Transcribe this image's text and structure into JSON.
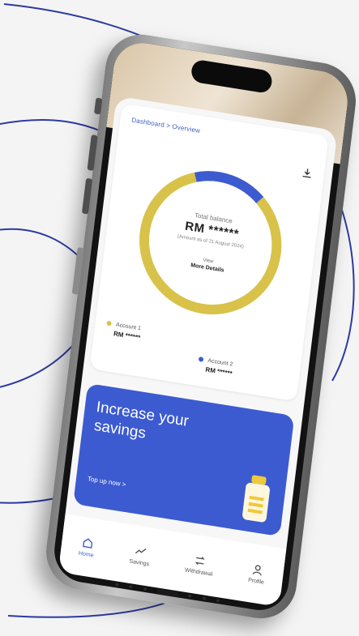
{
  "app": {
    "breadcrumb": "Dashboard > Overview",
    "summary": {
      "total_label": "Total balance",
      "total_value": "RM ******",
      "total_sub": "(Amount as of 21 August 2024)",
      "more_label": "View",
      "more_link": "More Details"
    },
    "donut": {
      "blue_fraction": 0.17,
      "colors": {
        "blue": "#3c5bd1",
        "gold": "#d8c24a"
      }
    },
    "legend": [
      {
        "label": "Account 1",
        "amount": "RM ******",
        "color": "#d8c24a"
      },
      {
        "label": "Account 2",
        "amount": "RM ******",
        "color": "#3c5bd1"
      }
    ],
    "promo": {
      "title": "Increase your savings",
      "cta": "Top up now >"
    },
    "nav": [
      {
        "label": "Home",
        "icon": "home-icon",
        "active": true
      },
      {
        "label": "Savings",
        "icon": "chart-line-icon",
        "active": false
      },
      {
        "label": "Withdrawal",
        "icon": "transfer-icon",
        "active": false
      },
      {
        "label": "Profile",
        "icon": "user-icon",
        "active": false
      }
    ]
  }
}
